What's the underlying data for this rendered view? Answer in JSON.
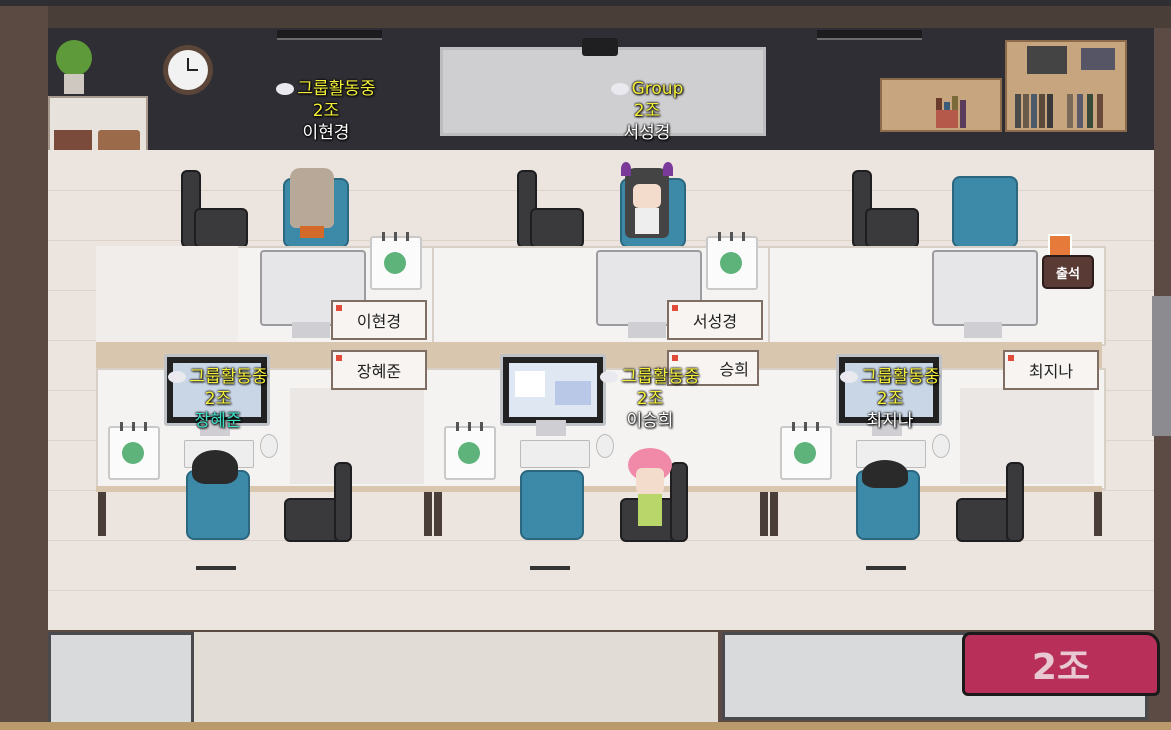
{
  "room": {
    "team_button_label": "2조",
    "attendance_label": "출석"
  },
  "nameplates": [
    {
      "id": "plate-lee-hyungyeong",
      "text": "이현경"
    },
    {
      "id": "plate-seo-seonggyeong",
      "text": "서성경"
    },
    {
      "id": "plate-jang-hyejun",
      "text": "장혜준"
    },
    {
      "id": "plate-lee-seunghui",
      "text": "승희"
    },
    {
      "id": "plate-choi-jina",
      "text": "최지나"
    }
  ],
  "players": [
    {
      "status": "그룹활동중",
      "team": "2조",
      "name": "이현경"
    },
    {
      "status": "Group",
      "team": "2조",
      "name": "서성경"
    },
    {
      "status": "그룹활동중",
      "team": "2조",
      "name": "장혜준"
    },
    {
      "status": "그룹활동중",
      "team": "2조",
      "name": "이승희"
    },
    {
      "status": "그룹활동중",
      "team": "2조",
      "name": "최지나"
    }
  ],
  "colors": {
    "status_text": "#f4ef3a",
    "self_name": "#3fe0c8",
    "team_button": "#b8305a"
  },
  "icons": [
    "clock-icon",
    "plant-icon",
    "calendar-icon",
    "chat-bubble-icon",
    "projector-icon",
    "attendance-icon"
  ]
}
